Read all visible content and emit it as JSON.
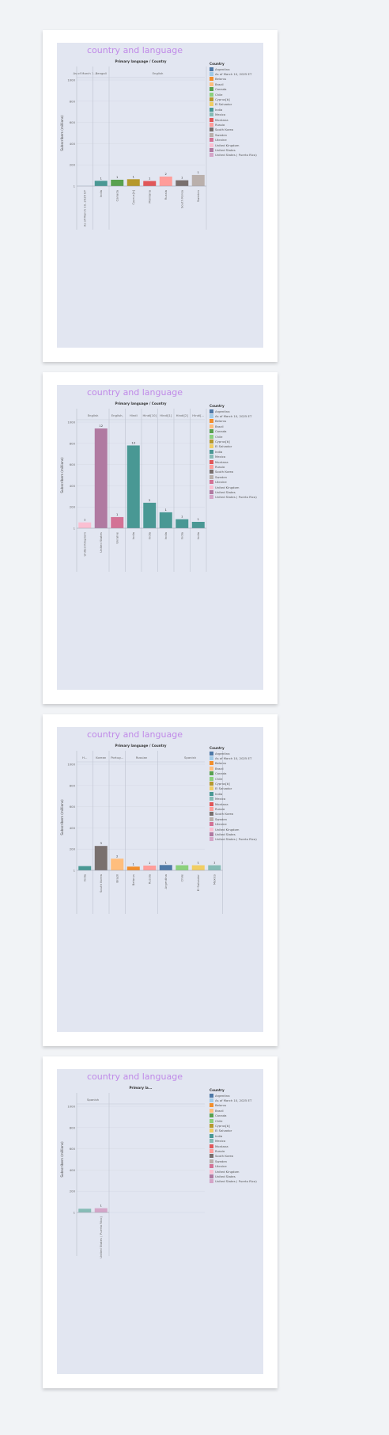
{
  "dashboard_title": "country and language",
  "legend": {
    "title": "Country",
    "items": [
      {
        "label": "Argentina",
        "color": "#4e79a7"
      },
      {
        "label": "As of March 10, 2025 ET",
        "color": "#a0cbe8"
      },
      {
        "label": "Belarus",
        "color": "#f28e2b"
      },
      {
        "label": "Brazil",
        "color": "#ffbe7d"
      },
      {
        "label": "Canada",
        "color": "#59a14f"
      },
      {
        "label": "Chile",
        "color": "#8cd17d"
      },
      {
        "label": "Cyprus[b]",
        "color": "#b6992d"
      },
      {
        "label": "El Salvador",
        "color": "#f1ce63"
      },
      {
        "label": "India",
        "color": "#499894"
      },
      {
        "label": "Mexico",
        "color": "#86bcb6"
      },
      {
        "label": "Montana",
        "color": "#e15759"
      },
      {
        "label": "Russia",
        "color": "#ff9d9a"
      },
      {
        "label": "South Korea",
        "color": "#79706e"
      },
      {
        "label": "Sweden",
        "color": "#bab0ac"
      },
      {
        "label": "Ukraine",
        "color": "#d37295"
      },
      {
        "label": "United Kingdom",
        "color": "#fabfd2"
      },
      {
        "label": "United States",
        "color": "#b07aa1"
      },
      {
        "label": "United States ( Puerto Rico)",
        "color": "#d4a6c8"
      }
    ]
  },
  "chart_data": [
    {
      "type": "bar",
      "title": "Primary language / Country",
      "ylabel": "Subscribers (millions)",
      "ylim": [
        0,
        1000
      ],
      "yticks": [
        1,
        200,
        400,
        600,
        800,
        1000
      ],
      "groups": [
        {
          "label": "As of March 1...",
          "categories": [
            {
              "name": "As of March 10, 2025 ET",
              "value": 1,
              "label": "",
              "color": "#a0cbe8"
            }
          ]
        },
        {
          "label": "Bengali",
          "categories": [
            {
              "name": "India",
              "value": 50,
              "label": "1",
              "color": "#499894"
            }
          ]
        },
        {
          "label": "English",
          "categories": [
            {
              "name": "Canada",
              "value": 60,
              "label": "1",
              "color": "#59a14f"
            },
            {
              "name": "Cyprus[b]",
              "value": 65,
              "label": "1",
              "color": "#b6992d"
            },
            {
              "name": "Montana",
              "value": 48,
              "label": "1",
              "color": "#e15759"
            },
            {
              "name": "Russia",
              "value": 90,
              "label": "2",
              "color": "#ff9d9a"
            },
            {
              "name": "South Korea",
              "value": 55,
              "label": "1",
              "color": "#79706e"
            },
            {
              "name": "Sweden",
              "value": 105,
              "label": "1",
              "color": "#bab0ac"
            }
          ]
        }
      ]
    },
    {
      "type": "bar",
      "title": "Primary language / Country",
      "ylabel": "Subscribers (millions)",
      "ylim": [
        0,
        1000
      ],
      "yticks": [
        1,
        200,
        400,
        600,
        800,
        1000
      ],
      "groups": [
        {
          "label": "English",
          "categories": [
            {
              "name": "United Kingdom",
              "value": 55,
              "label": "1",
              "color": "#fabfd2"
            },
            {
              "name": "United States",
              "value": 940,
              "label": "12",
              "color": "#b07aa1"
            }
          ]
        },
        {
          "label": "English,",
          "categories": [
            {
              "name": "Ukraine",
              "value": 105,
              "label": "1",
              "color": "#d37295"
            }
          ]
        },
        {
          "label": "Hindi",
          "categories": [
            {
              "name": "India",
              "value": 780,
              "label": "13",
              "color": "#499894"
            }
          ]
        },
        {
          "label": "Hindi[10]",
          "categories": [
            {
              "name": "India",
              "value": 240,
              "label": "2",
              "color": "#499894"
            }
          ]
        },
        {
          "label": "Hindi[1]",
          "categories": [
            {
              "name": "India",
              "value": 150,
              "label": "1",
              "color": "#499894"
            }
          ]
        },
        {
          "label": "Hindi[2]",
          "categories": [
            {
              "name": "India",
              "value": 85,
              "label": "1",
              "color": "#499894"
            }
          ]
        },
        {
          "label": "Hindi[...",
          "categories": [
            {
              "name": "India",
              "value": 60,
              "label": "1",
              "color": "#499894"
            }
          ]
        }
      ]
    },
    {
      "type": "bar",
      "title": "Primary language / Country",
      "ylabel": "Subscribers (millions)",
      "ylim": [
        0,
        1000
      ],
      "yticks": [
        1,
        200,
        400,
        600,
        800,
        1000
      ],
      "groups": [
        {
          "label": "H...",
          "categories": [
            {
              "name": "India",
              "value": 40,
              "label": "",
              "color": "#499894"
            }
          ]
        },
        {
          "label": "Korean",
          "categories": [
            {
              "name": "South Korea",
              "value": 230,
              "label": "3",
              "color": "#79706e"
            }
          ]
        },
        {
          "label": "Portug...",
          "categories": [
            {
              "name": "Brazil",
              "value": 110,
              "label": "2",
              "color": "#ffbe7d"
            }
          ]
        },
        {
          "label": "Russian",
          "categories": [
            {
              "name": "Belarus",
              "value": 35,
              "label": "1",
              "color": "#f28e2b"
            },
            {
              "name": "Russia",
              "value": 45,
              "label": "1",
              "color": "#ff9d9a"
            }
          ]
        },
        {
          "label": "Spanish",
          "categories": [
            {
              "name": "Argentina",
              "value": 50,
              "label": "1",
              "color": "#4e79a7"
            },
            {
              "name": "Chile",
              "value": 48,
              "label": "1",
              "color": "#8cd17d"
            },
            {
              "name": "El Salvador",
              "value": 48,
              "label": "1",
              "color": "#f1ce63"
            },
            {
              "name": "Mexico",
              "value": 48,
              "label": "1",
              "color": "#86bcb6"
            }
          ]
        }
      ]
    },
    {
      "type": "bar",
      "title": "Primary la...",
      "ylabel": "Subscribers (millions)",
      "ylim": [
        0,
        1000
      ],
      "yticks": [
        1,
        200,
        400,
        600,
        800,
        1000
      ],
      "groups": [
        {
          "label": "Spanish",
          "categories": [
            {
              "name": "",
              "value": 35,
              "label": "",
              "color": "#86bcb6"
            },
            {
              "name": "United States ( Puerto Rico)",
              "value": 40,
              "label": "1",
              "color": "#d4a6c8"
            }
          ]
        }
      ]
    }
  ]
}
